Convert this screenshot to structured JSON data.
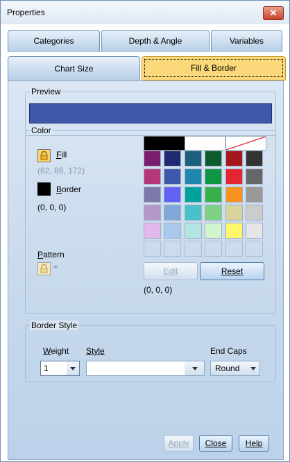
{
  "window": {
    "title": "Properties",
    "close_glyph": "✕"
  },
  "tabs": [
    {
      "label": "Categories"
    },
    {
      "label": "Depth & Angle"
    },
    {
      "label": "Variables"
    },
    {
      "label": "Chart Size"
    },
    {
      "label": "Fill & Border"
    }
  ],
  "active_tab": "Fill & Border",
  "preview": {
    "legend": "Preview",
    "fill_color": "#3e58ac"
  },
  "color": {
    "legend": "Color",
    "fill": {
      "label_prefix": "",
      "accel": "F",
      "label_rest": "ill",
      "rgb": "(62, 88, 172)"
    },
    "border": {
      "accel": "B",
      "label_rest": "order",
      "rgb": "(0, 0, 0)",
      "swatch_color": "#000000"
    },
    "pattern": {
      "accel": "P",
      "label_rest": "attern"
    },
    "top_swatches": [
      "#000000",
      "#ffffff",
      "none"
    ],
    "palette": [
      [
        "#7b1e6f",
        "#202a70",
        "#1b5f7d",
        "#0b5c2a",
        "#a4171c",
        "#333333"
      ],
      [
        "#b33779",
        "#3e58ac",
        "#1f86ac",
        "#0e9643",
        "#e3262f",
        "#666666"
      ],
      [
        "#7b79a7",
        "#6362f7",
        "#00a39b",
        "#37b14b",
        "#f7931e",
        "#999999"
      ],
      [
        "#b598c8",
        "#7fa8d9",
        "#48c1c8",
        "#7fd282",
        "#d8d39b",
        "#cccccc"
      ],
      [
        "#e0b8ec",
        "#a8c8ec",
        "#b0e5e3",
        "#d1f6cc",
        "#fef76a",
        "#e6e6e6"
      ]
    ],
    "edit_label": "Edit",
    "reset_label": "Reset",
    "selected_rgb": "(0, 0, 0)"
  },
  "border_style": {
    "legend": "Border Style",
    "weight_accel": "W",
    "weight_rest": "eight",
    "style_label": "Style",
    "end_caps_label": "End Caps",
    "weight_value": "1",
    "style_value": "",
    "end_caps_value": "Round"
  },
  "buttons": {
    "apply": "Apply",
    "close": "Close",
    "help": "Help"
  },
  "colors": {
    "accent_tab": "#fbd97a",
    "panel": "#dae6f3"
  }
}
